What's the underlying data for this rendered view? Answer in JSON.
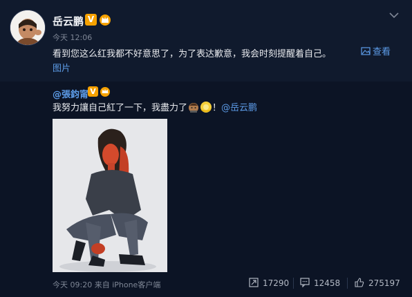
{
  "post": {
    "author": "岳云鹏",
    "verified_mark": "V",
    "time": "今天 12:06",
    "text": "看到您这么红我都不好意思了，为了表达歉意，我会时刻提醒着自己。",
    "view_link_part1": "查看",
    "view_link_part2": "图片",
    "icons": [
      "avatar",
      "verified-icon",
      "crown-icon",
      "chevron-down-icon",
      "image-icon"
    ]
  },
  "repost": {
    "author": "@張鈞甯",
    "verified_mark": "V",
    "text_main": "我努力讓自己紅了一下，我盡力了",
    "text_after_emoji": "！",
    "mention": "@岳云鹏",
    "icons": [
      "emoji-icon",
      "emoji-icon",
      "crown-icon",
      "verified-icon"
    ],
    "footer": {
      "time_source": "今天 09:20 来自 iPhone客户端",
      "reposts": "17290",
      "comments": "12458",
      "likes": "275197"
    }
  },
  "colors": {
    "background": "#0c1425",
    "post_background": "#101a2d",
    "link": "#5d9ce8",
    "badge": "#f5a100"
  }
}
